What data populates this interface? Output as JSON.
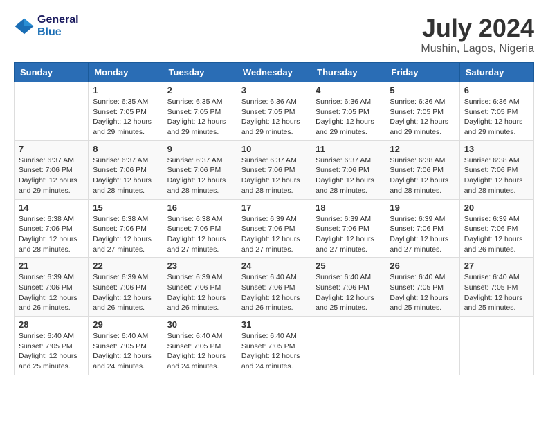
{
  "logo": {
    "line1": "General",
    "line2": "Blue"
  },
  "title": {
    "month_year": "July 2024",
    "location": "Mushin, Lagos, Nigeria"
  },
  "days_of_week": [
    "Sunday",
    "Monday",
    "Tuesday",
    "Wednesday",
    "Thursday",
    "Friday",
    "Saturday"
  ],
  "weeks": [
    [
      {
        "day": "",
        "info": ""
      },
      {
        "day": "1",
        "info": "Sunrise: 6:35 AM\nSunset: 7:05 PM\nDaylight: 12 hours\nand 29 minutes."
      },
      {
        "day": "2",
        "info": "Sunrise: 6:35 AM\nSunset: 7:05 PM\nDaylight: 12 hours\nand 29 minutes."
      },
      {
        "day": "3",
        "info": "Sunrise: 6:36 AM\nSunset: 7:05 PM\nDaylight: 12 hours\nand 29 minutes."
      },
      {
        "day": "4",
        "info": "Sunrise: 6:36 AM\nSunset: 7:05 PM\nDaylight: 12 hours\nand 29 minutes."
      },
      {
        "day": "5",
        "info": "Sunrise: 6:36 AM\nSunset: 7:05 PM\nDaylight: 12 hours\nand 29 minutes."
      },
      {
        "day": "6",
        "info": "Sunrise: 6:36 AM\nSunset: 7:05 PM\nDaylight: 12 hours\nand 29 minutes."
      }
    ],
    [
      {
        "day": "7",
        "info": "Sunrise: 6:37 AM\nSunset: 7:06 PM\nDaylight: 12 hours\nand 29 minutes."
      },
      {
        "day": "8",
        "info": "Sunrise: 6:37 AM\nSunset: 7:06 PM\nDaylight: 12 hours\nand 28 minutes."
      },
      {
        "day": "9",
        "info": "Sunrise: 6:37 AM\nSunset: 7:06 PM\nDaylight: 12 hours\nand 28 minutes."
      },
      {
        "day": "10",
        "info": "Sunrise: 6:37 AM\nSunset: 7:06 PM\nDaylight: 12 hours\nand 28 minutes."
      },
      {
        "day": "11",
        "info": "Sunrise: 6:37 AM\nSunset: 7:06 PM\nDaylight: 12 hours\nand 28 minutes."
      },
      {
        "day": "12",
        "info": "Sunrise: 6:38 AM\nSunset: 7:06 PM\nDaylight: 12 hours\nand 28 minutes."
      },
      {
        "day": "13",
        "info": "Sunrise: 6:38 AM\nSunset: 7:06 PM\nDaylight: 12 hours\nand 28 minutes."
      }
    ],
    [
      {
        "day": "14",
        "info": "Sunrise: 6:38 AM\nSunset: 7:06 PM\nDaylight: 12 hours\nand 28 minutes."
      },
      {
        "day": "15",
        "info": "Sunrise: 6:38 AM\nSunset: 7:06 PM\nDaylight: 12 hours\nand 27 minutes."
      },
      {
        "day": "16",
        "info": "Sunrise: 6:38 AM\nSunset: 7:06 PM\nDaylight: 12 hours\nand 27 minutes."
      },
      {
        "day": "17",
        "info": "Sunrise: 6:39 AM\nSunset: 7:06 PM\nDaylight: 12 hours\nand 27 minutes."
      },
      {
        "day": "18",
        "info": "Sunrise: 6:39 AM\nSunset: 7:06 PM\nDaylight: 12 hours\nand 27 minutes."
      },
      {
        "day": "19",
        "info": "Sunrise: 6:39 AM\nSunset: 7:06 PM\nDaylight: 12 hours\nand 27 minutes."
      },
      {
        "day": "20",
        "info": "Sunrise: 6:39 AM\nSunset: 7:06 PM\nDaylight: 12 hours\nand 26 minutes."
      }
    ],
    [
      {
        "day": "21",
        "info": "Sunrise: 6:39 AM\nSunset: 7:06 PM\nDaylight: 12 hours\nand 26 minutes."
      },
      {
        "day": "22",
        "info": "Sunrise: 6:39 AM\nSunset: 7:06 PM\nDaylight: 12 hours\nand 26 minutes."
      },
      {
        "day": "23",
        "info": "Sunrise: 6:39 AM\nSunset: 7:06 PM\nDaylight: 12 hours\nand 26 minutes."
      },
      {
        "day": "24",
        "info": "Sunrise: 6:40 AM\nSunset: 7:06 PM\nDaylight: 12 hours\nand 26 minutes."
      },
      {
        "day": "25",
        "info": "Sunrise: 6:40 AM\nSunset: 7:06 PM\nDaylight: 12 hours\nand 25 minutes."
      },
      {
        "day": "26",
        "info": "Sunrise: 6:40 AM\nSunset: 7:05 PM\nDaylight: 12 hours\nand 25 minutes."
      },
      {
        "day": "27",
        "info": "Sunrise: 6:40 AM\nSunset: 7:05 PM\nDaylight: 12 hours\nand 25 minutes."
      }
    ],
    [
      {
        "day": "28",
        "info": "Sunrise: 6:40 AM\nSunset: 7:05 PM\nDaylight: 12 hours\nand 25 minutes."
      },
      {
        "day": "29",
        "info": "Sunrise: 6:40 AM\nSunset: 7:05 PM\nDaylight: 12 hours\nand 24 minutes."
      },
      {
        "day": "30",
        "info": "Sunrise: 6:40 AM\nSunset: 7:05 PM\nDaylight: 12 hours\nand 24 minutes."
      },
      {
        "day": "31",
        "info": "Sunrise: 6:40 AM\nSunset: 7:05 PM\nDaylight: 12 hours\nand 24 minutes."
      },
      {
        "day": "",
        "info": ""
      },
      {
        "day": "",
        "info": ""
      },
      {
        "day": "",
        "info": ""
      }
    ]
  ]
}
